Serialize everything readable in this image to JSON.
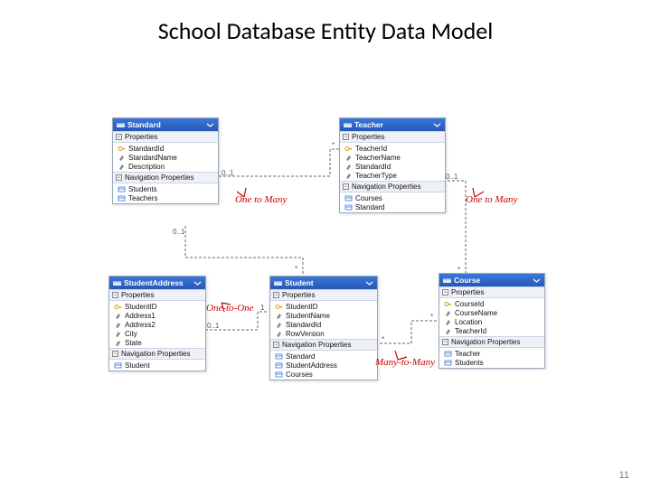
{
  "title": "School Database Entity Data Model",
  "page_number": "11",
  "sections": {
    "properties": "Properties",
    "nav": "Navigation Properties"
  },
  "entities": {
    "standard": {
      "name": "Standard",
      "props": [
        "StandardId",
        "StandardName",
        "Description"
      ],
      "navs": [
        "Students",
        "Teachers"
      ]
    },
    "teacher": {
      "name": "Teacher",
      "props": [
        "TeacherId",
        "TeacherName",
        "StandardId",
        "TeacherType"
      ],
      "navs": [
        "Courses",
        "Standard"
      ]
    },
    "studentaddress": {
      "name": "StudentAddress",
      "props": [
        "StudentID",
        "Address1",
        "Address2",
        "City",
        "State"
      ],
      "navs": [
        "Student"
      ]
    },
    "student": {
      "name": "Student",
      "props": [
        "StudentID",
        "StudentName",
        "StandardId",
        "RowVersion"
      ],
      "navs": [
        "Standard",
        "StudentAddress",
        "Courses"
      ]
    },
    "course": {
      "name": "Course",
      "props": [
        "CourseId",
        "CourseName",
        "Location",
        "TeacherId"
      ],
      "navs": [
        "Teacher",
        "Students"
      ]
    }
  },
  "labels": {
    "one_to_many_1": "One to Many",
    "one_to_many_2": "One to Many",
    "one_to_one": "One-to-One",
    "many_to_many": "Many-to-Many"
  },
  "cardinalities": {
    "c1": "0..1",
    "c2": "*",
    "c3": "0..1",
    "c4": "*",
    "c5": "0..1",
    "c6": "1",
    "c7": "*",
    "c8": "*",
    "c9": "*",
    "c10": "0..1"
  }
}
